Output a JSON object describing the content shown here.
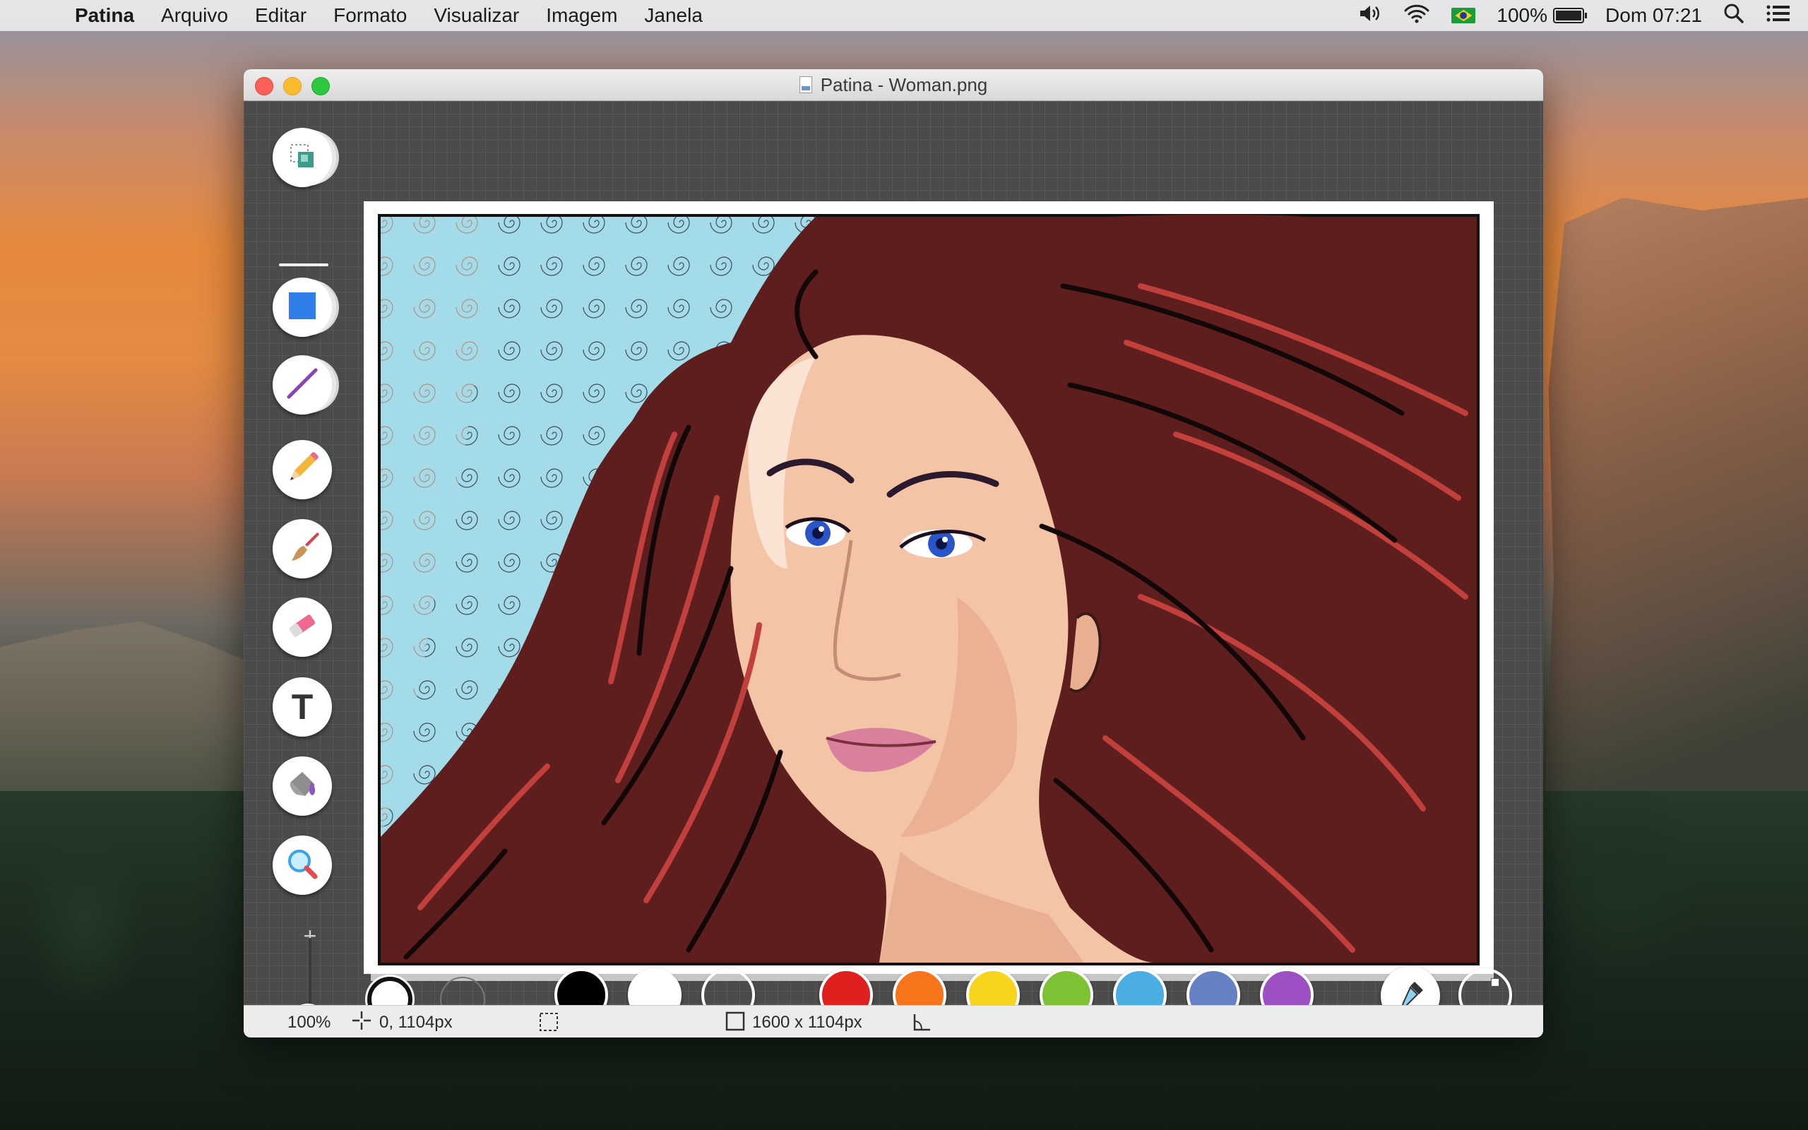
{
  "menubar": {
    "app_name": "Patina",
    "items": [
      "Arquivo",
      "Editar",
      "Formato",
      "Visualizar",
      "Imagem",
      "Janela"
    ],
    "battery": "100%",
    "battery_level": 1.0,
    "clock": "Dom 07:21"
  },
  "window": {
    "title": "Patina - Woman.png"
  },
  "tools": [
    {
      "name": "selection-tool",
      "icon": "selection-icon"
    },
    {
      "name": "rectangle-tool",
      "icon": "rectangle-icon"
    },
    {
      "name": "line-tool",
      "icon": "line-icon"
    },
    {
      "name": "pencil-tool",
      "icon": "pencil-icon"
    },
    {
      "name": "brush-tool",
      "icon": "brush-icon"
    },
    {
      "name": "eraser-tool",
      "icon": "eraser-icon"
    },
    {
      "name": "text-tool",
      "icon": "text-icon",
      "glyph": "T"
    },
    {
      "name": "fill-bucket-tool",
      "icon": "paint-bucket-icon"
    },
    {
      "name": "zoom-tool",
      "icon": "magnifier-icon"
    }
  ],
  "zoom_controls": {
    "plus": "+",
    "minus": "−"
  },
  "palette": {
    "colors": [
      {
        "name": "black",
        "hex": "#000000"
      },
      {
        "name": "white",
        "hex": "#ffffff"
      },
      {
        "name": "transparent",
        "hex": "none"
      },
      {
        "name": "red",
        "hex": "#e0201f"
      },
      {
        "name": "orange",
        "hex": "#f7741b"
      },
      {
        "name": "yellow",
        "hex": "#f7d51e"
      },
      {
        "name": "green",
        "hex": "#7dc234"
      },
      {
        "name": "sky-blue",
        "hex": "#4aaee3"
      },
      {
        "name": "periwinkle",
        "hex": "#6680c4"
      },
      {
        "name": "purple",
        "hex": "#9d4fc4"
      }
    ]
  },
  "status": {
    "zoom": "100%",
    "cursor": "0, 1104px",
    "dimensions": "1600 x 1104px"
  },
  "image": {
    "subject": "painted portrait of a woman with red hair",
    "colors": {
      "background_swirls": "#a3dbe8",
      "hair_dark": "#5e1e1d",
      "hair_highlight": "#c2403c",
      "skin": "#f3c4a6"
    }
  }
}
